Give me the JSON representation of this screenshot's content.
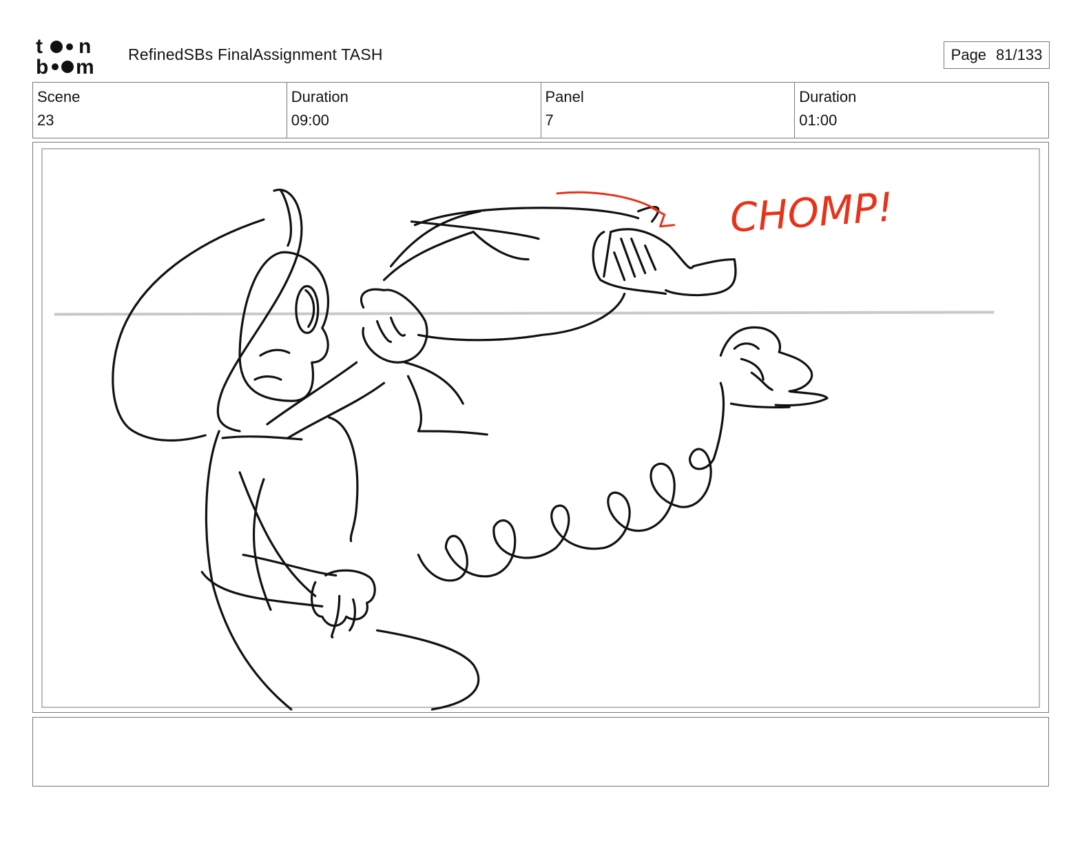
{
  "header": {
    "logo_line1": "toon",
    "logo_line2": "boom",
    "title": "RefinedSBs FinalAssignment TASH",
    "page_label": "Page",
    "page_value": "81/133"
  },
  "info": [
    {
      "label": "Scene",
      "value": "23"
    },
    {
      "label": "Duration",
      "value": "09:00"
    },
    {
      "label": "Panel",
      "value": "7"
    },
    {
      "label": "Duration",
      "value": "01:00"
    }
  ],
  "panel": {
    "sfx_text": "CHOMP!",
    "sfx_color": "#e8321a",
    "line_color": "#111111",
    "horizon_color": "#c8c8c8"
  },
  "notes": {
    "text": ""
  }
}
